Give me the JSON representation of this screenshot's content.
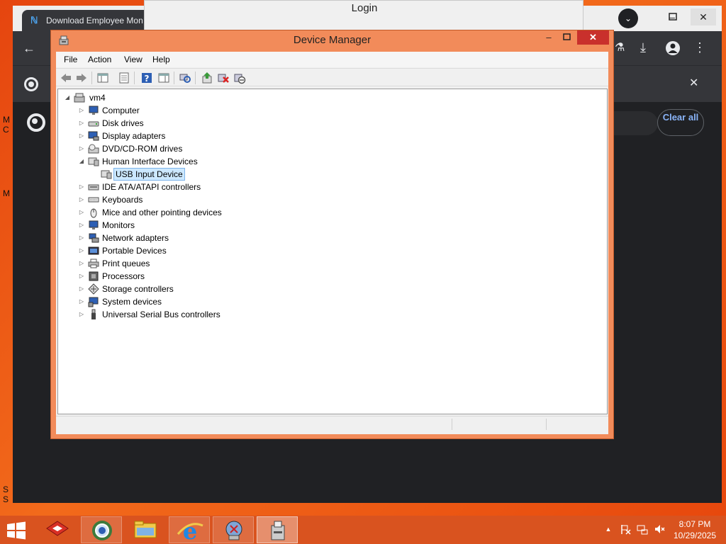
{
  "browser": {
    "tab_title": "Download Employee Mon",
    "clear_all": "Clear all",
    "left_fragments": [
      "M",
      "C",
      "M",
      "S",
      "S"
    ]
  },
  "login_window": {
    "title": "Login"
  },
  "device_manager": {
    "title": "Device Manager",
    "menu": [
      "File",
      "Action",
      "View",
      "Help"
    ],
    "toolbar_icons": [
      "back-icon",
      "forward-icon",
      "show-hide-tree-icon",
      "properties-icon",
      "help-icon",
      "action-pane-icon",
      "scan-hardware-icon",
      "update-driver-icon",
      "uninstall-icon",
      "disable-icon"
    ],
    "tree": {
      "root": "vm4",
      "categories": [
        {
          "label": "Computer",
          "expanded": false
        },
        {
          "label": "Disk drives",
          "expanded": false
        },
        {
          "label": "Display adapters",
          "expanded": false
        },
        {
          "label": "DVD/CD-ROM drives",
          "expanded": false
        },
        {
          "label": "Human Interface Devices",
          "expanded": true,
          "children": [
            "USB Input Device"
          ]
        },
        {
          "label": "IDE ATA/ATAPI controllers",
          "expanded": false
        },
        {
          "label": "Keyboards",
          "expanded": false
        },
        {
          "label": "Mice and other pointing devices",
          "expanded": false
        },
        {
          "label": "Monitors",
          "expanded": false
        },
        {
          "label": "Network adapters",
          "expanded": false
        },
        {
          "label": "Portable Devices",
          "expanded": false
        },
        {
          "label": "Print queues",
          "expanded": false
        },
        {
          "label": "Processors",
          "expanded": false
        },
        {
          "label": "Storage controllers",
          "expanded": false
        },
        {
          "label": "System devices",
          "expanded": false
        },
        {
          "label": "Universal Serial Bus controllers",
          "expanded": false
        }
      ],
      "selected": "USB Input Device"
    }
  },
  "taskbar": {
    "apps": [
      "device-manager-red-icon",
      "chrome-app-icon",
      "file-explorer-icon",
      "internet-explorer-icon",
      "network-globe-icon",
      "device-manager-active-icon"
    ],
    "time": "8:07 PM",
    "date": "10/29/2025"
  },
  "colors": {
    "desktop": "#e94e0f",
    "window_frame": "#f28b5a",
    "close_button": "#c9302c",
    "selection": "#cce8ff"
  }
}
